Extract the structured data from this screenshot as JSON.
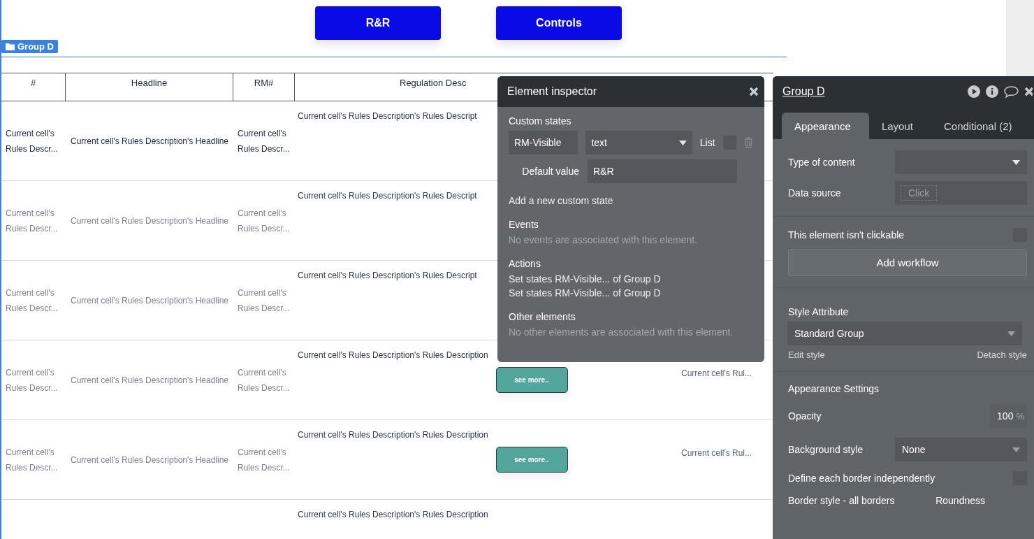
{
  "canvas": {
    "buttons": [
      {
        "label": "R&R"
      },
      {
        "label": "Controls"
      }
    ],
    "group_label": "Group D",
    "table": {
      "columns": [
        "#",
        "Headline",
        "RM#",
        "Regulation Desc"
      ],
      "rows": [
        {
          "highlighted": true,
          "number": "Current cell's Rules Descr...",
          "headline": "Current cell's Rules Description's Headline",
          "rm": "Current cell's Rules Descr...",
          "description": "Current cell's Rules Description's Rules Descript"
        },
        {
          "highlighted": false,
          "number": "Current cell's Rules Descr...",
          "headline": "Current cell's Rules Description's Headline",
          "rm": "Current cell's Rules Descr...",
          "description": "Current cell's Rules Description's Rules Descript"
        },
        {
          "highlighted": false,
          "number": "Current cell's Rules Descr...",
          "headline": "Current cell's Rules Description's Headline",
          "rm": "Current cell's Rules Descr...",
          "description": "Current cell's Rules Description's Rules Descript"
        },
        {
          "highlighted": false,
          "number": "Current cell's Rules Descr...",
          "headline": "Current cell's Rules Description's Headline",
          "rm": "Current cell's Rules Descr...",
          "description": "Current cell's Rules Description's Rules Description",
          "button": "see more..",
          "column_6": "Current cell's Rul..."
        },
        {
          "highlighted": false,
          "number": "Current cell's Rules Descr...",
          "headline": "Current cell's Rules Description's Headline",
          "rm": "Current cell's Rules Descr...",
          "description": "Current cell's Rules Description's Rules Description",
          "button": "see more..",
          "column_6": "Current cell's Rul..."
        },
        {
          "description": "Current cell's Rules Description's Rules Description"
        }
      ]
    }
  },
  "inspector": {
    "title": "Element inspector",
    "custom_states_heading": "Custom states",
    "state_name": "RM-Visible",
    "state_type": "text",
    "list_label": "List",
    "list_checked": false,
    "default_label": "Default value",
    "default_value": "R&R",
    "add_state": "Add a new custom state",
    "sections": [
      {
        "heading": "Events",
        "items": [
          {
            "text": "No events are associated with this element.",
            "muted": true
          }
        ]
      },
      {
        "heading": "Actions",
        "items": [
          {
            "text": "Set states RM-Visible... of Group D",
            "muted": false
          },
          {
            "text": "Set states RM-Visible... of Group D",
            "muted": false
          }
        ]
      },
      {
        "heading": "Other elements",
        "items": [
          {
            "text": "No other elements are associated with this element.",
            "muted": true
          }
        ]
      }
    ]
  },
  "property_editor": {
    "title": "Group D",
    "tabs": [
      {
        "label": "Appearance",
        "selected": true
      },
      {
        "label": "Layout",
        "selected": false
      },
      {
        "label": "Conditional (2)",
        "selected": false
      }
    ],
    "type_of_content_label": "Type of content",
    "data_source_label": "Data source",
    "data_source_placeholder": "Click",
    "not_clickable_label": "This element isn't clickable",
    "not_clickable_checked": false,
    "add_workflow": "Add workflow",
    "style_attribute_label": "Style Attribute",
    "style_value": "Standard Group",
    "edit_style": "Edit style",
    "detach_style": "Detach style",
    "appearance_settings": "Appearance Settings",
    "opacity_label": "Opacity",
    "opacity_value": "100",
    "opacity_unit": "%",
    "background_label": "Background style",
    "background_value": "None",
    "independent_borders_label": "Define each border independently",
    "independent_borders_checked": false,
    "border_style_label": "Border style - all borders",
    "roundness_label": "Roundness"
  }
}
